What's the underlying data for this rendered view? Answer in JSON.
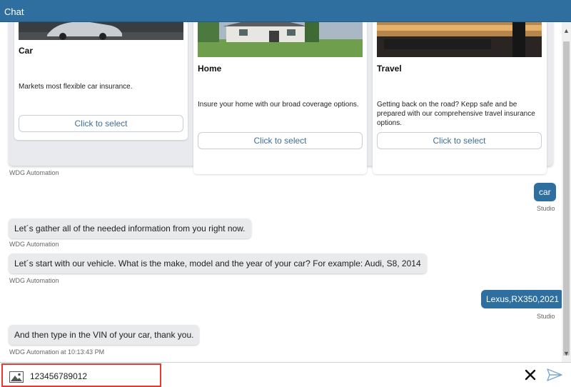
{
  "window": {
    "title": "Chat"
  },
  "carousel": {
    "cards": [
      {
        "title": "Car",
        "description": "Markets most flexible car insurance.",
        "button": "Click to select"
      },
      {
        "title": "Home",
        "description": "Insure your home with our broad coverage options.",
        "button": "Click to select"
      },
      {
        "title": "Travel",
        "description": "Getting back on the road? Kepp safe and be prepared with our comprehensive travel insurance options.",
        "button": "Click to select"
      }
    ],
    "caption": "WDG Automation"
  },
  "messages": [
    {
      "side": "right",
      "text": "car",
      "caption": "Studio"
    },
    {
      "side": "left",
      "text": "Let´s gather all of the needed information from you right now.",
      "caption": "WDG Automation"
    },
    {
      "side": "left",
      "text": "Let´s start with our vehicle. What is the make, model and the year of your car? For example: Audi, S8, 2014",
      "caption": "WDG Automation"
    },
    {
      "side": "right",
      "text": "Lexus,RX350,2021",
      "caption": "Studio"
    },
    {
      "side": "left",
      "text": "And then type in the VIN of your car, thank you.",
      "caption": "WDG Automation at 10:13:43 PM"
    }
  ],
  "composer": {
    "value": "123456789012"
  },
  "icons": {
    "image": "image-icon",
    "clear": "close-icon",
    "send": "send-icon"
  },
  "colors": {
    "accent": "#2f6f9f",
    "highlight": "#e53935"
  }
}
